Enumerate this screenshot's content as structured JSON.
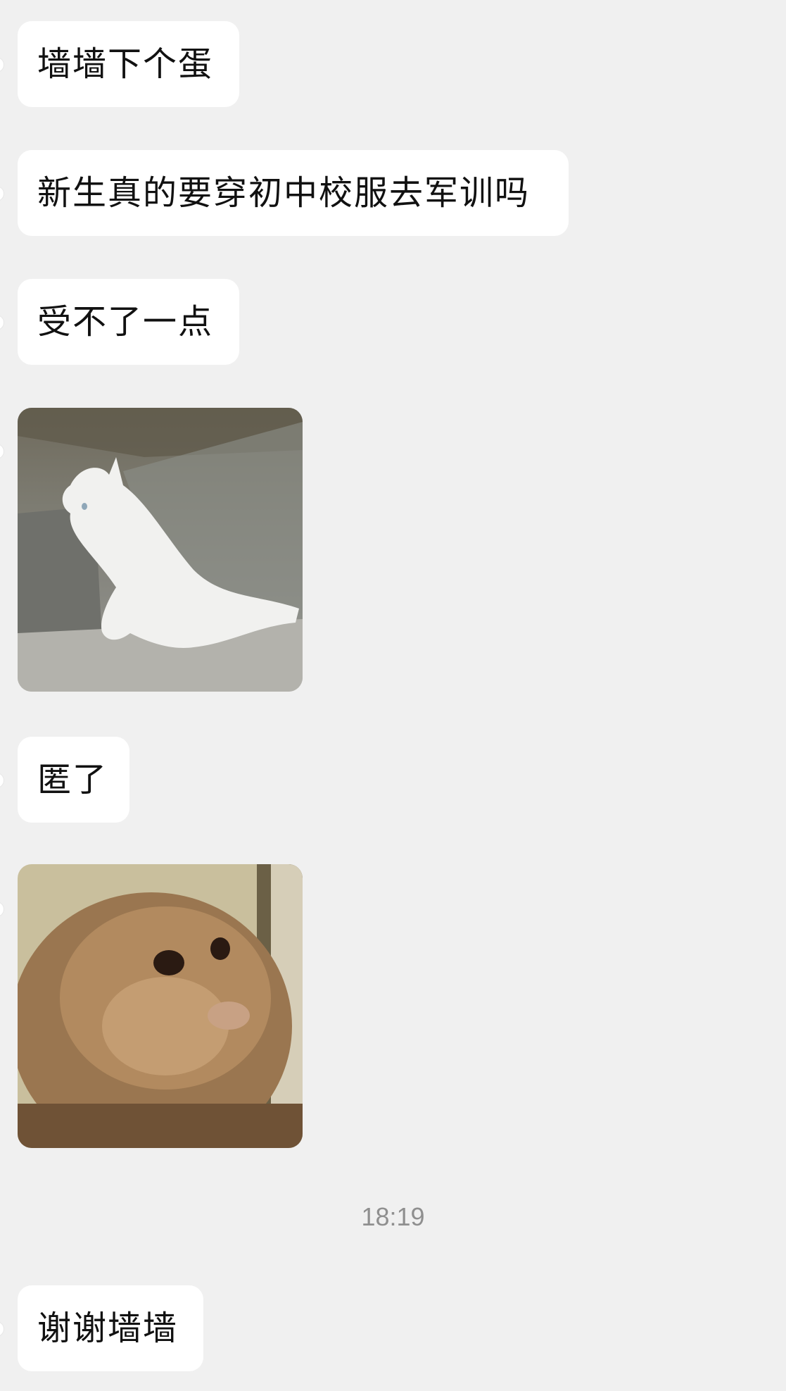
{
  "messages": [
    {
      "type": "text",
      "text": "墙墙下个蛋"
    },
    {
      "type": "text",
      "text": "新生真的要穿初中校服去军训吗"
    },
    {
      "type": "text",
      "text": "受不了一点"
    },
    {
      "type": "sticker",
      "icon": "white-cat-sitting-sticker"
    },
    {
      "type": "text",
      "text": "匿了"
    },
    {
      "type": "sticker",
      "icon": "orange-cat-face-sticker"
    },
    {
      "type": "timestamp",
      "text": "18:19"
    },
    {
      "type": "text",
      "text": "谢谢墙墙"
    }
  ],
  "colors": {
    "background": "#f0f0f0",
    "bubble": "#ffffff",
    "timestamp": "#8f8f8f"
  }
}
